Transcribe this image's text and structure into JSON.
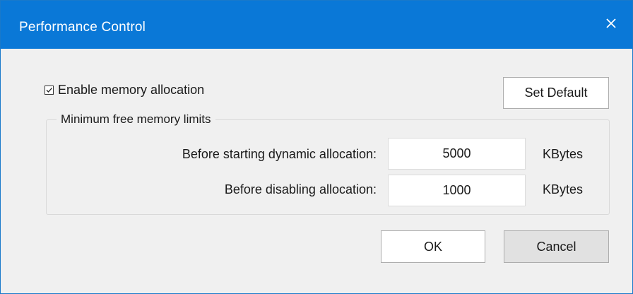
{
  "window": {
    "title": "Performance Control",
    "close_icon": "close-icon"
  },
  "memory_allocation": {
    "enable_label": "Enable memory allocation",
    "enabled": true
  },
  "buttons": {
    "set_default": "Set Default",
    "ok": "OK",
    "cancel": "Cancel"
  },
  "limits_group": {
    "title": "Minimum free memory limits",
    "fields": [
      {
        "label": "Before starting dynamic allocation:",
        "value": "5000",
        "unit": "KBytes"
      },
      {
        "label": "Before disabling allocation:",
        "value": "1000",
        "unit": "KBytes"
      }
    ]
  },
  "colors": {
    "titlebar": "#0a78d7",
    "background": "#f0f0f0"
  }
}
